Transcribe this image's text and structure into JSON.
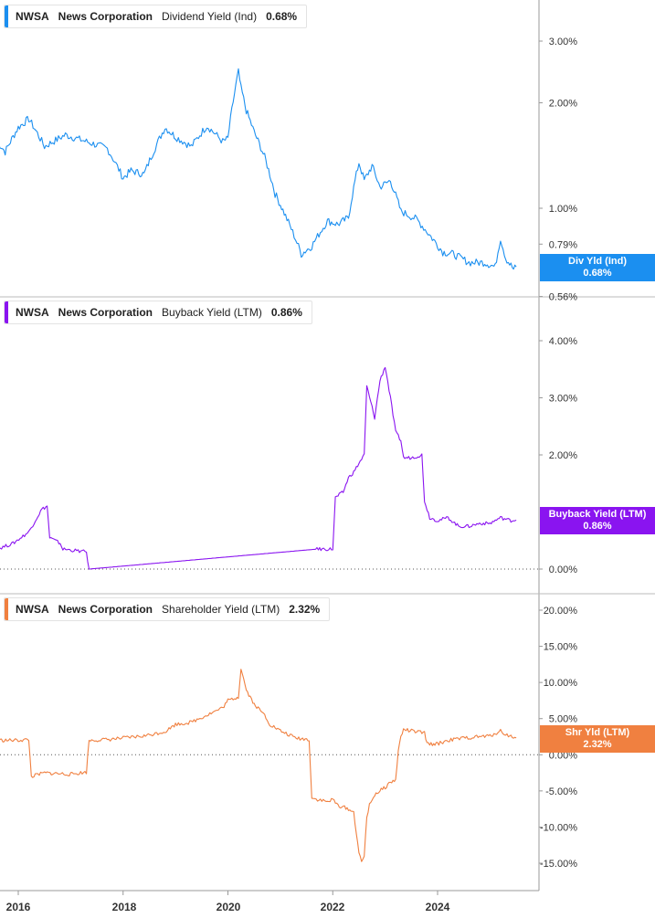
{
  "colors": {
    "dividend": "#1b8ff0",
    "buyback": "#8a14f0",
    "shareholder": "#f08040"
  },
  "x_axis": {
    "labels": [
      "2016",
      "2018",
      "2020",
      "2022",
      "2024"
    ]
  },
  "panels": [
    {
      "ticker": "NWSA",
      "company": "News Corporation",
      "metric": "Dividend Yield (Ind)",
      "value": "0.68%",
      "tag_line1": "Div Yld (Ind)",
      "tag_line2": "0.68%",
      "ticks": [
        "3.00%",
        "2.00%",
        "1.00%",
        "0.79%",
        "0.56%"
      ]
    },
    {
      "ticker": "NWSA",
      "company": "News Corporation",
      "metric": "Buyback Yield (LTM)",
      "value": "0.86%",
      "tag_line1": "Buyback Yield (LTM)",
      "tag_line2": "0.86%",
      "ticks": [
        "4.00%",
        "3.00%",
        "2.00%",
        "0.00%"
      ]
    },
    {
      "ticker": "NWSA",
      "company": "News Corporation",
      "metric": "Shareholder Yield (LTM)",
      "value": "2.32%",
      "tag_line1": "Shr Yld (LTM)",
      "tag_line2": "2.32%",
      "ticks": [
        "20.00%",
        "15.00%",
        "10.00%",
        "5.00%",
        "0.00%",
        "-5.00%",
        "-10.00%",
        "-15.00%"
      ]
    }
  ],
  "chart_data": [
    {
      "type": "line",
      "title": "NWSA News Corporation Dividend Yield (Ind) 0.68%",
      "yscale": "log",
      "ylim": [
        0.56,
        3.3
      ],
      "xlim": [
        2015.6,
        2025.8
      ],
      "series": [
        {
          "name": "Dividend Yield (Ind)",
          "x": [
            2015.6,
            2015.75,
            2016.0,
            2016.2,
            2016.5,
            2016.9,
            2017.3,
            2017.7,
            2018.0,
            2018.15,
            2018.4,
            2018.8,
            2019.0,
            2019.3,
            2019.6,
            2019.9,
            2020.0,
            2020.2,
            2020.25,
            2020.35,
            2020.5,
            2020.7,
            2020.9,
            2021.1,
            2021.4,
            2021.6,
            2021.9,
            2022.1,
            2022.3,
            2022.5,
            2022.6,
            2022.75,
            2022.9,
            2023.1,
            2023.3,
            2023.6,
            2023.9,
            2024.1,
            2024.3,
            2024.6,
            2024.9,
            2025.1,
            2025.2,
            2025.3,
            2025.45,
            2025.5
          ],
          "y": [
            1.55,
            1.45,
            1.7,
            1.8,
            1.5,
            1.62,
            1.55,
            1.48,
            1.22,
            1.28,
            1.25,
            1.7,
            1.6,
            1.5,
            1.72,
            1.55,
            1.58,
            2.45,
            2.2,
            1.9,
            1.65,
            1.4,
            1.1,
            0.95,
            0.74,
            0.78,
            0.92,
            0.9,
            0.94,
            1.35,
            1.2,
            1.32,
            1.15,
            1.2,
            0.98,
            0.93,
            0.82,
            0.75,
            0.74,
            0.7,
            0.7,
            0.68,
            0.82,
            0.72,
            0.67,
            0.68
          ]
        }
      ]
    },
    {
      "type": "line",
      "title": "NWSA News Corporation Buyback Yield (LTM) 0.86%",
      "ylim": [
        0.0,
        4.0
      ],
      "xlim": [
        2015.6,
        2025.8
      ],
      "series": [
        {
          "name": "Buyback Yield (LTM)",
          "x": [
            2015.6,
            2015.9,
            2016.2,
            2016.45,
            2016.55,
            2016.6,
            2016.8,
            2016.85,
            2017.3,
            2017.35,
            2021.7,
            2021.85,
            2022.0,
            2022.05,
            2022.2,
            2022.3,
            2022.4,
            2022.6,
            2022.65,
            2022.8,
            2022.9,
            2023.0,
            2023.1,
            2023.2,
            2023.3,
            2023.35,
            2023.5,
            2023.7,
            2023.75,
            2023.85,
            2024.0,
            2024.2,
            2024.4,
            2024.6,
            2024.8,
            2025.0,
            2025.2,
            2025.4,
            2025.5
          ],
          "y": [
            0.35,
            0.45,
            0.65,
            1.05,
            1.1,
            0.55,
            0.45,
            0.35,
            0.3,
            0.0,
            0.35,
            0.35,
            0.35,
            1.25,
            1.35,
            1.6,
            1.7,
            2.0,
            3.2,
            2.65,
            3.3,
            3.55,
            3.0,
            2.4,
            2.25,
            1.95,
            1.95,
            2.0,
            1.2,
            0.9,
            0.85,
            0.9,
            0.75,
            0.75,
            0.8,
            0.8,
            0.9,
            0.85,
            0.86
          ]
        }
      ]
    },
    {
      "type": "line",
      "title": "NWSA News Corporation Shareholder Yield (LTM) 2.32%",
      "ylim": [
        -15.0,
        20.0
      ],
      "xlim": [
        2015.6,
        2025.8
      ],
      "series": [
        {
          "name": "Shareholder Yield (LTM)",
          "x": [
            2015.6,
            2016.0,
            2016.2,
            2016.25,
            2016.5,
            2017.0,
            2017.3,
            2017.35,
            2017.7,
            2018.0,
            2018.4,
            2018.8,
            2019.0,
            2019.3,
            2019.6,
            2019.9,
            2020.0,
            2020.2,
            2020.25,
            2020.35,
            2020.5,
            2020.7,
            2020.8,
            2021.0,
            2021.3,
            2021.55,
            2021.6,
            2021.9,
            2022.0,
            2022.1,
            2022.3,
            2022.4,
            2022.5,
            2022.55,
            2022.6,
            2022.65,
            2022.7,
            2022.8,
            2023.0,
            2023.1,
            2023.2,
            2023.25,
            2023.3,
            2023.35,
            2023.5,
            2023.75,
            2023.8,
            2024.0,
            2024.2,
            2024.5,
            2024.8,
            2025.0,
            2025.2,
            2025.3,
            2025.5
          ],
          "y": [
            2.0,
            2.0,
            2.1,
            -3.0,
            -2.5,
            -2.7,
            -2.4,
            2.0,
            2.1,
            2.3,
            2.6,
            3.2,
            4.2,
            4.5,
            5.5,
            6.5,
            7.5,
            8.0,
            12.0,
            9.0,
            7.0,
            5.5,
            4.2,
            3.3,
            2.3,
            2.1,
            -6.0,
            -6.5,
            -6.2,
            -7.0,
            -7.5,
            -8.0,
            -13.5,
            -15.0,
            -14.0,
            -8.5,
            -7.0,
            -5.5,
            -4.5,
            -3.8,
            -3.5,
            0.5,
            2.5,
            3.5,
            3.3,
            3.0,
            1.5,
            1.5,
            2.0,
            2.3,
            2.5,
            2.6,
            3.3,
            2.8,
            2.32
          ]
        }
      ]
    }
  ]
}
